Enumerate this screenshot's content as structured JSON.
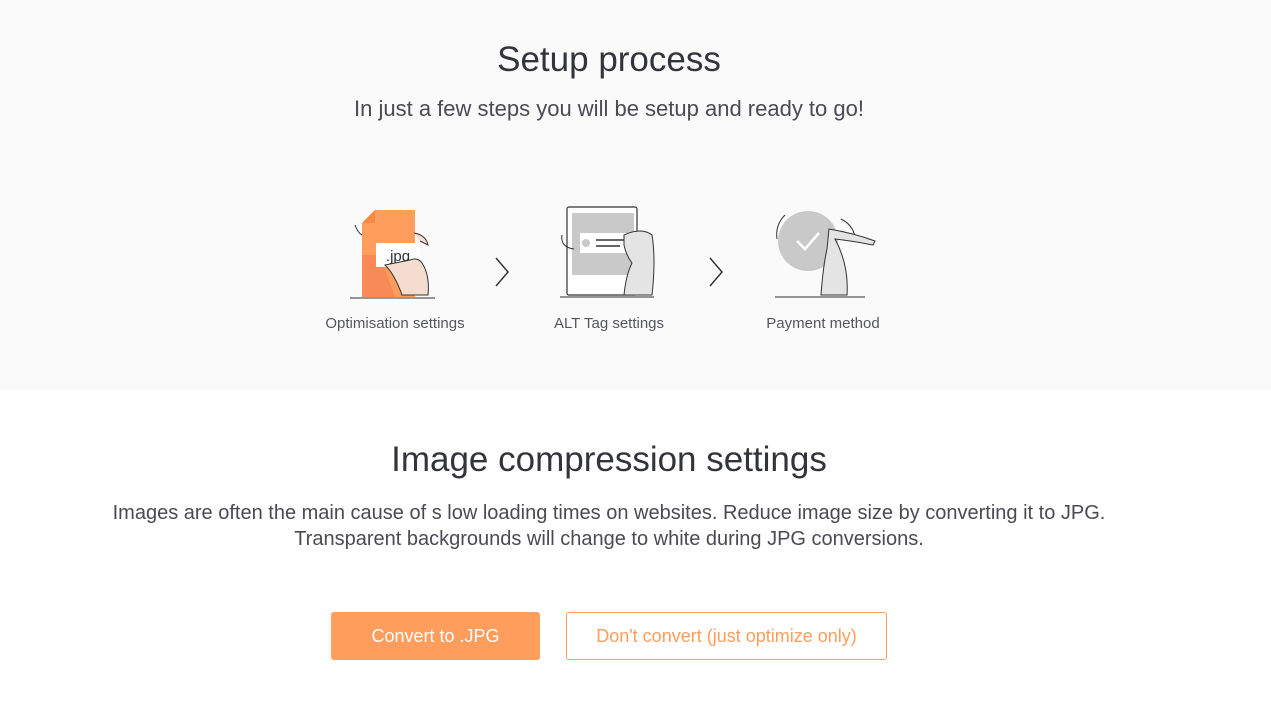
{
  "setup": {
    "title": "Setup process",
    "subtitle": "In just a few steps you will be setup and ready to go!",
    "steps": [
      {
        "label": "Optimisation settings",
        "icon": "jpg-file-icon",
        "badge": ".jpg"
      },
      {
        "label": "ALT Tag settings",
        "icon": "alt-tag-icon"
      },
      {
        "label": "Payment method",
        "icon": "checkmark-circle-icon"
      }
    ]
  },
  "compression": {
    "title": "Image compression settings",
    "description": "Images are often the main cause of s low loading times on websites. Reduce image size by converting it to JPG. Transparent backgrounds will change to white during JPG conversions.",
    "convert_button": "Convert to .JPG",
    "skip_button": "Don't convert (just optimize only)"
  },
  "colors": {
    "accent": "#ff9d5c",
    "top_background": "#fafafa",
    "text": "#33343b"
  }
}
